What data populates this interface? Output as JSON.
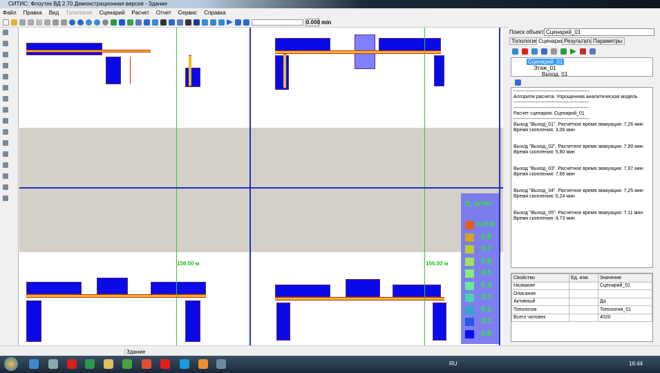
{
  "window": {
    "title": "СИТИС: Флоутек  ВД 2.70  Демонстрационная версия - Здание"
  },
  "menu": [
    {
      "label": "Файл",
      "enabled": true
    },
    {
      "label": "Правка",
      "enabled": true
    },
    {
      "label": "Вид",
      "enabled": true
    },
    {
      "label": "Топология",
      "enabled": false
    },
    {
      "label": "Сценарий",
      "enabled": true
    },
    {
      "label": "Расчет",
      "enabled": true
    },
    {
      "label": "Отчет",
      "enabled": true
    },
    {
      "label": "Сервис",
      "enabled": true
    },
    {
      "label": "Справка",
      "enabled": true
    }
  ],
  "toolbar": {
    "time_value": "0.000",
    "time_unit": "min"
  },
  "canvas": {
    "dimension_left": "156.00 м",
    "dimension_right": "156.00 м"
  },
  "legend": {
    "title": "D, m²/m²",
    "items": [
      {
        "label": ">=0.9",
        "color": "#e05a1a"
      },
      {
        "label": "0.8",
        "color": "#d4a020"
      },
      {
        "label": "0.7",
        "color": "#b8cc30"
      },
      {
        "label": "0.6",
        "color": "#9ee050"
      },
      {
        "label": "0.5",
        "color": "#80f070"
      },
      {
        "label": "0.4",
        "color": "#60e890"
      },
      {
        "label": "0.3",
        "color": "#40d0a8"
      },
      {
        "label": "0.2",
        "color": "#2aa0c8"
      },
      {
        "label": "0.1",
        "color": "#1a50e0"
      },
      {
        "label": "0.0",
        "color": "#0000f0"
      }
    ]
  },
  "panel": {
    "search_label": "Поиск объекта",
    "search_value": "Сценарий_01",
    "tabs": [
      "Топология",
      "Сценарии",
      "Результаты",
      "Параметры"
    ],
    "active_tab": "Сценарии",
    "tree": [
      "Сценарий_01",
      "Этаж_01",
      "Выход_01"
    ],
    "log": [
      "-----------------------------------------------",
      "Алгоритм расчета: Упрощенная аналитическая модель",
      "-----------------------------------------------",
      "-----------------------------------------------",
      "Расчет сценария: Сценарий_01",
      "-----------------------------------------------",
      "Выход \"Выход_01\". Расчетное время эвакуации: 7,26 мин",
      "Время скопления: 3,06 мин",
      "",
      "",
      "Выход \"Выход_02\". Расчетное время эвакуации: 7,99 мин",
      "Время скопления: 5,80 мин",
      "",
      "",
      "Выход \"Выход_03\". Расчетное время эвакуации: 7,97 мин",
      "Время скопления: 7,66 мин",
      "",
      "",
      "Выход \"Выход_04\". Расчетное время эвакуации: 7,25 мин",
      "Время скопления: 6,24 мин",
      "",
      "",
      "Выход \"Выход_05\". Расчетное время эвакуации: 7,11 мин",
      "Время скопления: 4,73 мин"
    ],
    "props_headers": [
      "Свойство",
      "Ед. изм.",
      "Значение"
    ],
    "props": [
      [
        "Название",
        "",
        "Сценарий_01"
      ],
      [
        "Описание",
        "",
        ""
      ],
      [
        "Активный",
        "",
        "Да"
      ],
      [
        "Топология",
        "",
        "Топология_01"
      ],
      [
        "Всего человек",
        "",
        "4020"
      ]
    ]
  },
  "status": {
    "text": "Здание"
  },
  "taskbar": {
    "lang": "RU",
    "clock": "16:44"
  }
}
